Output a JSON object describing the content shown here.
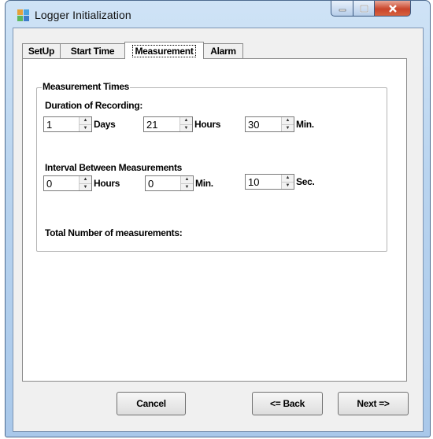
{
  "window": {
    "title": "Logger Initialization",
    "icon": "app-icon"
  },
  "colors": {
    "titlebar": "#b9d4ef",
    "close_button": "#c9452b",
    "client_bg": "#f0f0f0",
    "panel_bg": "#ffffff"
  },
  "tabs": [
    {
      "label": "SetUp",
      "active": false
    },
    {
      "label": "Start Time",
      "active": false
    },
    {
      "label": "Measurement",
      "active": true
    },
    {
      "label": "Alarm",
      "active": false
    }
  ],
  "measurement": {
    "group_title": "Measurement Times",
    "duration": {
      "label": "Duration of Recording:",
      "days": {
        "value": "1",
        "unit": "Days"
      },
      "hours": {
        "value": "21",
        "unit": "Hours"
      },
      "minutes": {
        "value": "30",
        "unit": "Min."
      }
    },
    "interval": {
      "label": "Interval Between Measurements",
      "hours": {
        "value": "0",
        "unit": "Hours"
      },
      "minutes": {
        "value": "0",
        "unit": "Min."
      },
      "seconds": {
        "value": "10",
        "unit": "Sec."
      }
    },
    "total_label": "Total Number of measurements:"
  },
  "buttons": {
    "cancel": "Cancel",
    "back": "<= Back",
    "next": "Next =>"
  }
}
